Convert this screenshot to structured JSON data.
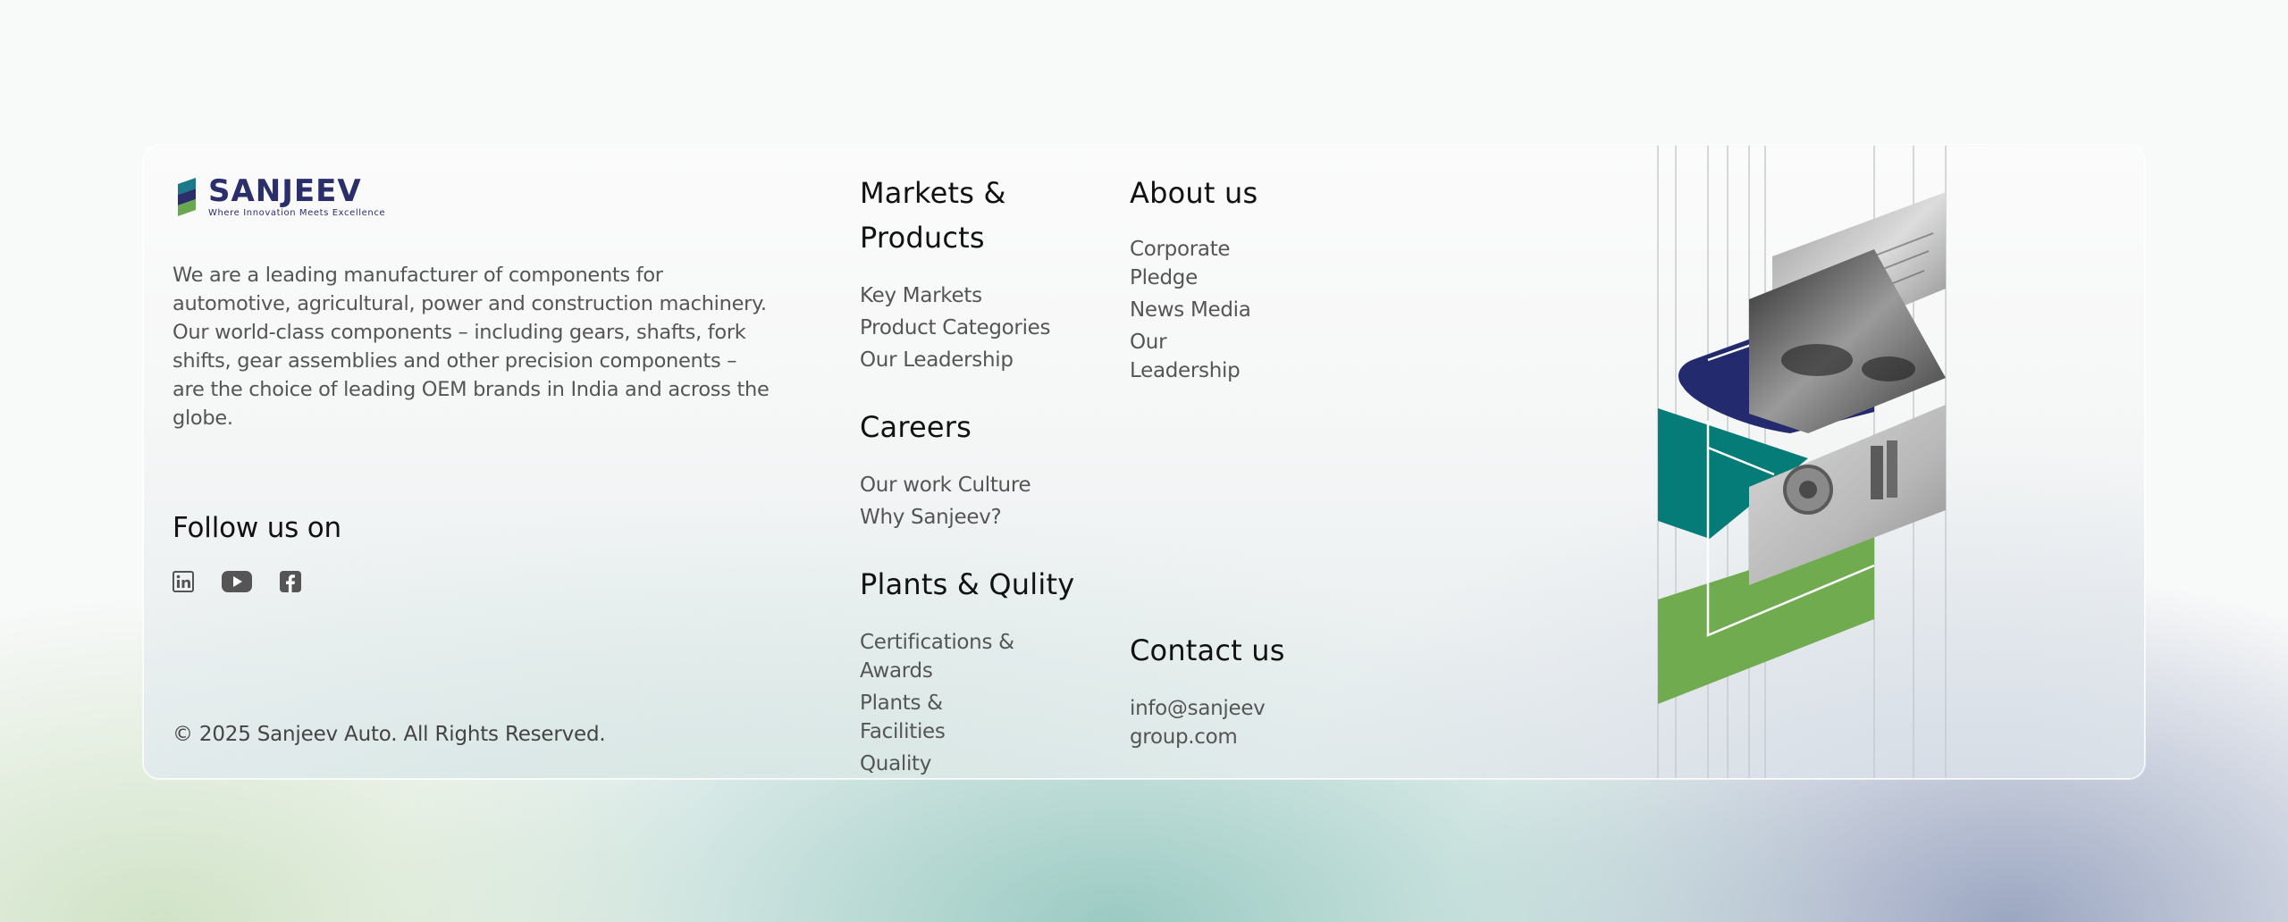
{
  "brand": {
    "name": "SANJEEV",
    "tagline": "Where Innovation Meets Excellence",
    "colors": {
      "navy": "#2a2f6c",
      "teal": "#1a7a8a",
      "green": "#6aa84f"
    }
  },
  "about": {
    "description": "We are a leading manufacturer of components for automotive, agricultural, power and construction machinery. Our world-class components – including gears, shafts, fork shifts, gear assemblies and other precision components – are the choice of leading OEM brands in India and across the globe."
  },
  "social": {
    "title": "Follow us on",
    "icons": [
      "linkedin-icon",
      "youtube-icon",
      "facebook-icon"
    ]
  },
  "copyright": "© 2025 Sanjeev Auto. All Rights Reserved.",
  "columns": {
    "markets": {
      "heading": "Markets & Products",
      "items": [
        "Key Markets",
        "Product Categories",
        "Our Leadership"
      ]
    },
    "careers": {
      "heading": "Careers",
      "items": [
        "Our work Culture",
        "Why Sanjeev?"
      ]
    },
    "plants": {
      "heading": "Plants & Qulity",
      "items": [
        "Certifications & Awards",
        "Plants & Facilities",
        "Quality Initiatives"
      ]
    },
    "about_us": {
      "heading": "About us",
      "items": [
        "Corporate Pledge",
        "News Media",
        "Our Leadership"
      ]
    },
    "contact": {
      "heading": "Contact us",
      "email": "info@sanjeevgroup.com"
    }
  },
  "graphic": {
    "colors": {
      "navy": "#232a6e",
      "teal": "#057c78",
      "green": "#71ab4f",
      "line": "#c6cbd0"
    }
  }
}
